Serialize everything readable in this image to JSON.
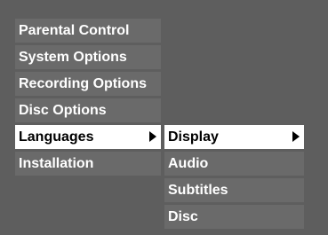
{
  "main_menu": {
    "items": [
      {
        "label": "Parental Control",
        "selected": false
      },
      {
        "label": "System Options",
        "selected": false
      },
      {
        "label": "Recording Options",
        "selected": false
      },
      {
        "label": "Disc Options",
        "selected": false
      },
      {
        "label": "Languages",
        "selected": true
      },
      {
        "label": "Installation",
        "selected": false
      }
    ]
  },
  "submenu": {
    "items": [
      {
        "label": "Display",
        "selected": true
      },
      {
        "label": "Audio",
        "selected": false
      },
      {
        "label": "Subtitles",
        "selected": false
      },
      {
        "label": "Disc",
        "selected": false
      }
    ]
  },
  "icons": {
    "submenu_arrow": "right-triangle-arrow-icon"
  },
  "colors": {
    "background": "#5e5e5e",
    "item_background": "#6a6a6a",
    "selected_background": "#ffffff",
    "item_text": "#ffffff",
    "selected_text": "#000000"
  }
}
